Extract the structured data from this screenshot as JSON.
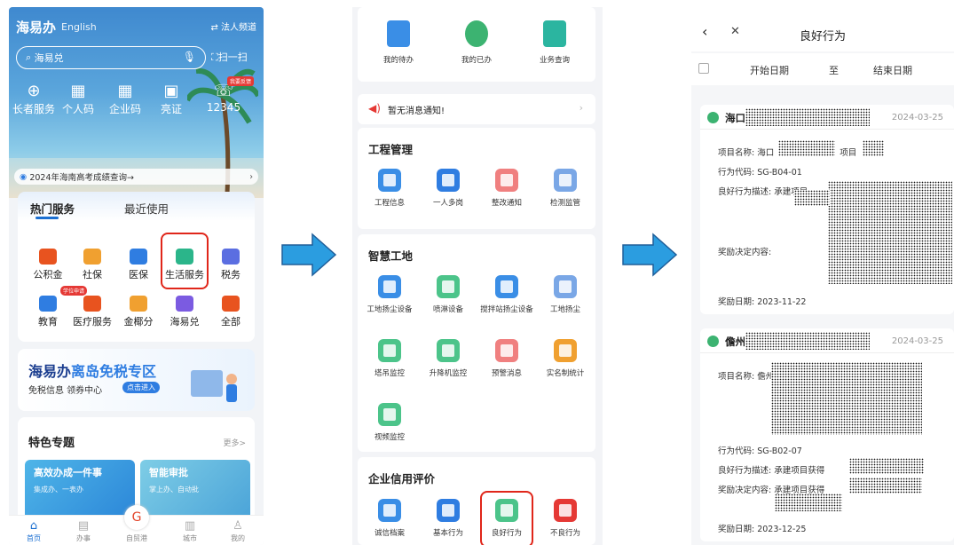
{
  "phone1": {
    "brand": "海易办",
    "lang": "English",
    "legal_channel": "⇄ 法人频道",
    "search_placeholder": "海易兑",
    "scan": "扫一扫",
    "quick": [
      "长者服务",
      "个人码",
      "企业码",
      "亮证",
      "12345"
    ],
    "feedback_badge": "我要反馈",
    "notice": "2024年海南高考成绩查询→",
    "tab_hot": "热门服务",
    "tab_recent": "最近使用",
    "services_row1": [
      "公积金",
      "社保",
      "医保",
      "生活服务",
      "税务"
    ],
    "services_row2": [
      "教育",
      "医疗服务",
      "金椰分",
      "海易兑",
      "全部"
    ],
    "study_badge": "学位申请",
    "duty_title_a": "海易办",
    "duty_title_b": "离岛免税专区",
    "duty_sub": "免税信息 领券中心",
    "duty_btn": "点击进入",
    "feature_title": "特色专题",
    "feature_more": "更多>",
    "feature_card1_a": "高效办成一件事",
    "feature_card1_b": "集成办、一表办",
    "feature_card2_a": "智能审批",
    "feature_card2_b": "掌上办、自动批",
    "nav": [
      "首页",
      "办事",
      "自贸港",
      "城市",
      "我的"
    ]
  },
  "phone2": {
    "top_items": [
      "我的待办",
      "我的已办",
      "业务查询"
    ],
    "message": "暂无消息通知!",
    "sec1_title": "工程管理",
    "sec1_items": [
      "工程信息",
      "一人多岗",
      "整改通知",
      "检测监管"
    ],
    "sec2_title": "智慧工地",
    "sec2_items": [
      "工地扬尘设备",
      "喷淋设备",
      "搅拌站扬尘设备",
      "工地扬尘",
      "塔吊监控",
      "升降机监控",
      "预警消息",
      "实名制统计",
      "视频监控"
    ],
    "sec3_title": "企业信用评价",
    "sec3_items": [
      "诚信档案",
      "基本行为",
      "良好行为",
      "不良行为"
    ]
  },
  "phone3": {
    "title": "良好行为",
    "start_date": "开始日期",
    "to": "至",
    "end_date": "结束日期",
    "records": [
      {
        "place": "海口",
        "date": "2024-03-25",
        "name_label": "项目名称: 海口",
        "name_suffix": "项目",
        "code": "行为代码: SG-B04-01",
        "desc": "良好行为描述: 承建项目",
        "decision": "奖励决定内容:",
        "award": "奖励日期: 2023-11-22"
      },
      {
        "place": "儋州",
        "date": "2024-03-25",
        "name_label": "项目名称: 儋州",
        "code": "行为代码: SG-B02-07",
        "desc": "良好行为描述: 承建项目获得",
        "decision": "奖励决定内容: 承建项目获得",
        "decision_suffix": "奖",
        "award": "奖励日期: 2023-12-25"
      }
    ]
  },
  "colors": {
    "accent": "#1b6fd1",
    "highlight": "#e0261a",
    "arrow": "#2b9de0",
    "like": "#3cb371"
  }
}
